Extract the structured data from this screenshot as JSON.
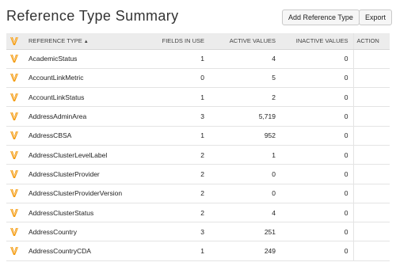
{
  "header": {
    "title": "Reference Type Summary",
    "add_label": "Add Reference Type",
    "export_label": "Export"
  },
  "colors": {
    "accent": "#f39c12",
    "header_bg": "#ececec"
  },
  "icons": {
    "header_icon": "v-logo-icon",
    "row_icon": "v-logo-icon",
    "sort_indicator": "sort-ascending-icon"
  },
  "table": {
    "columns": {
      "type": "REFERENCE TYPE",
      "sort_arrow": "▲",
      "fields": "FIELDS IN USE",
      "active": "ACTIVE VALUES",
      "inactive": "INACTIVE VALUES",
      "action": "ACTION"
    },
    "rows": [
      {
        "type": "AcademicStatus",
        "fields": "1",
        "active": "4",
        "inactive": "0"
      },
      {
        "type": "AccountLinkMetric",
        "fields": "0",
        "active": "5",
        "inactive": "0"
      },
      {
        "type": "AccountLinkStatus",
        "fields": "1",
        "active": "2",
        "inactive": "0"
      },
      {
        "type": "AddressAdminArea",
        "fields": "3",
        "active": "5,719",
        "inactive": "0"
      },
      {
        "type": "AddressCBSA",
        "fields": "1",
        "active": "952",
        "inactive": "0"
      },
      {
        "type": "AddressClusterLevelLabel",
        "fields": "2",
        "active": "1",
        "inactive": "0"
      },
      {
        "type": "AddressClusterProvider",
        "fields": "2",
        "active": "0",
        "inactive": "0"
      },
      {
        "type": "AddressClusterProviderVersion",
        "fields": "2",
        "active": "0",
        "inactive": "0"
      },
      {
        "type": "AddressClusterStatus",
        "fields": "2",
        "active": "4",
        "inactive": "0"
      },
      {
        "type": "AddressCountry",
        "fields": "3",
        "active": "251",
        "inactive": "0"
      },
      {
        "type": "AddressCountryCDA",
        "fields": "1",
        "active": "249",
        "inactive": "0"
      }
    ]
  }
}
